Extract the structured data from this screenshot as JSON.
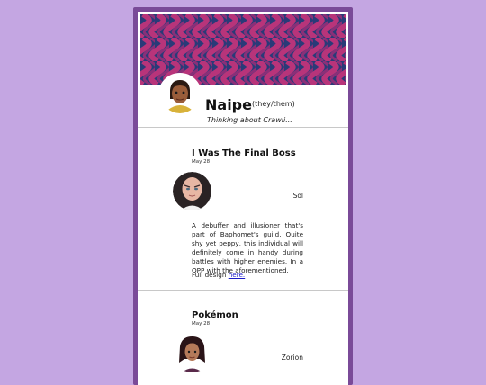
{
  "profile": {
    "name": "Naipe",
    "pronouns": "(they/them)",
    "status": "Thinking about Crawli..."
  },
  "colors": {
    "background": "#c4a6e2",
    "card_border": "#7a4a98",
    "banner_pink": "#b8347a",
    "banner_navy": "#2a3a78",
    "link": "#1a1ac8"
  },
  "posts": [
    {
      "title": "I Was The Final Boss",
      "date": "May 28",
      "author": "Sol",
      "body": "A debuffer and illusioner that's part of Baphomet's guild. Quite shy yet peppy, this individual will definitely come in handy during battles with higher enemies. In a QPP with the aforementioned.",
      "link_prefix": "Full design",
      "link_text": "here."
    },
    {
      "title": "Pokémon",
      "date": "May 28",
      "author": "Zorion"
    }
  ]
}
